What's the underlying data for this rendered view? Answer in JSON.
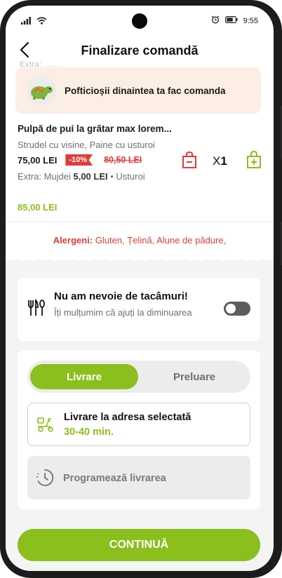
{
  "status_bar": {
    "time": "9:55"
  },
  "header": {
    "title": "Finalizare comandă"
  },
  "scroll_hint": "Extra: ......",
  "banner": {
    "text": "Pofticioșii dinaintea ta fac comanda"
  },
  "product": {
    "name": "Pulpă de pui la grătar max lorem...",
    "description": "Strudel cu visine, Paine cu usturoi",
    "price": "75,00 LEI",
    "discount": "-10%",
    "old_price": "80,50 LEI",
    "extra_label": "Extra: Mujdei ",
    "extra_price": "5,00 LEI",
    "extra_item": " • Usturoi",
    "quantity_prefix": "X",
    "quantity": "1",
    "total": "85,00 LEI"
  },
  "allergens": {
    "label": "Alergeni:",
    "values": " Gluten, Țelină, Alune de pădure,"
  },
  "cutlery": {
    "title": "Nu am nevoie de tacâmuri!",
    "subtitle": "Îți mulțumim că ajuți la diminuarea",
    "toggle_on": false
  },
  "delivery": {
    "tabs": [
      {
        "label": "Livrare",
        "selected": true
      },
      {
        "label": "Preluare",
        "selected": false
      }
    ],
    "address_option": {
      "title": "Livrare la adresa selectată",
      "eta": "30-40 min."
    },
    "schedule_option": {
      "title": "Programează livrarea"
    }
  },
  "cta": {
    "label": "CONTINUĂ"
  },
  "colors": {
    "accent": "#8bbf1d",
    "danger": "#e23a3a",
    "banner_bg": "#fdeee5"
  }
}
